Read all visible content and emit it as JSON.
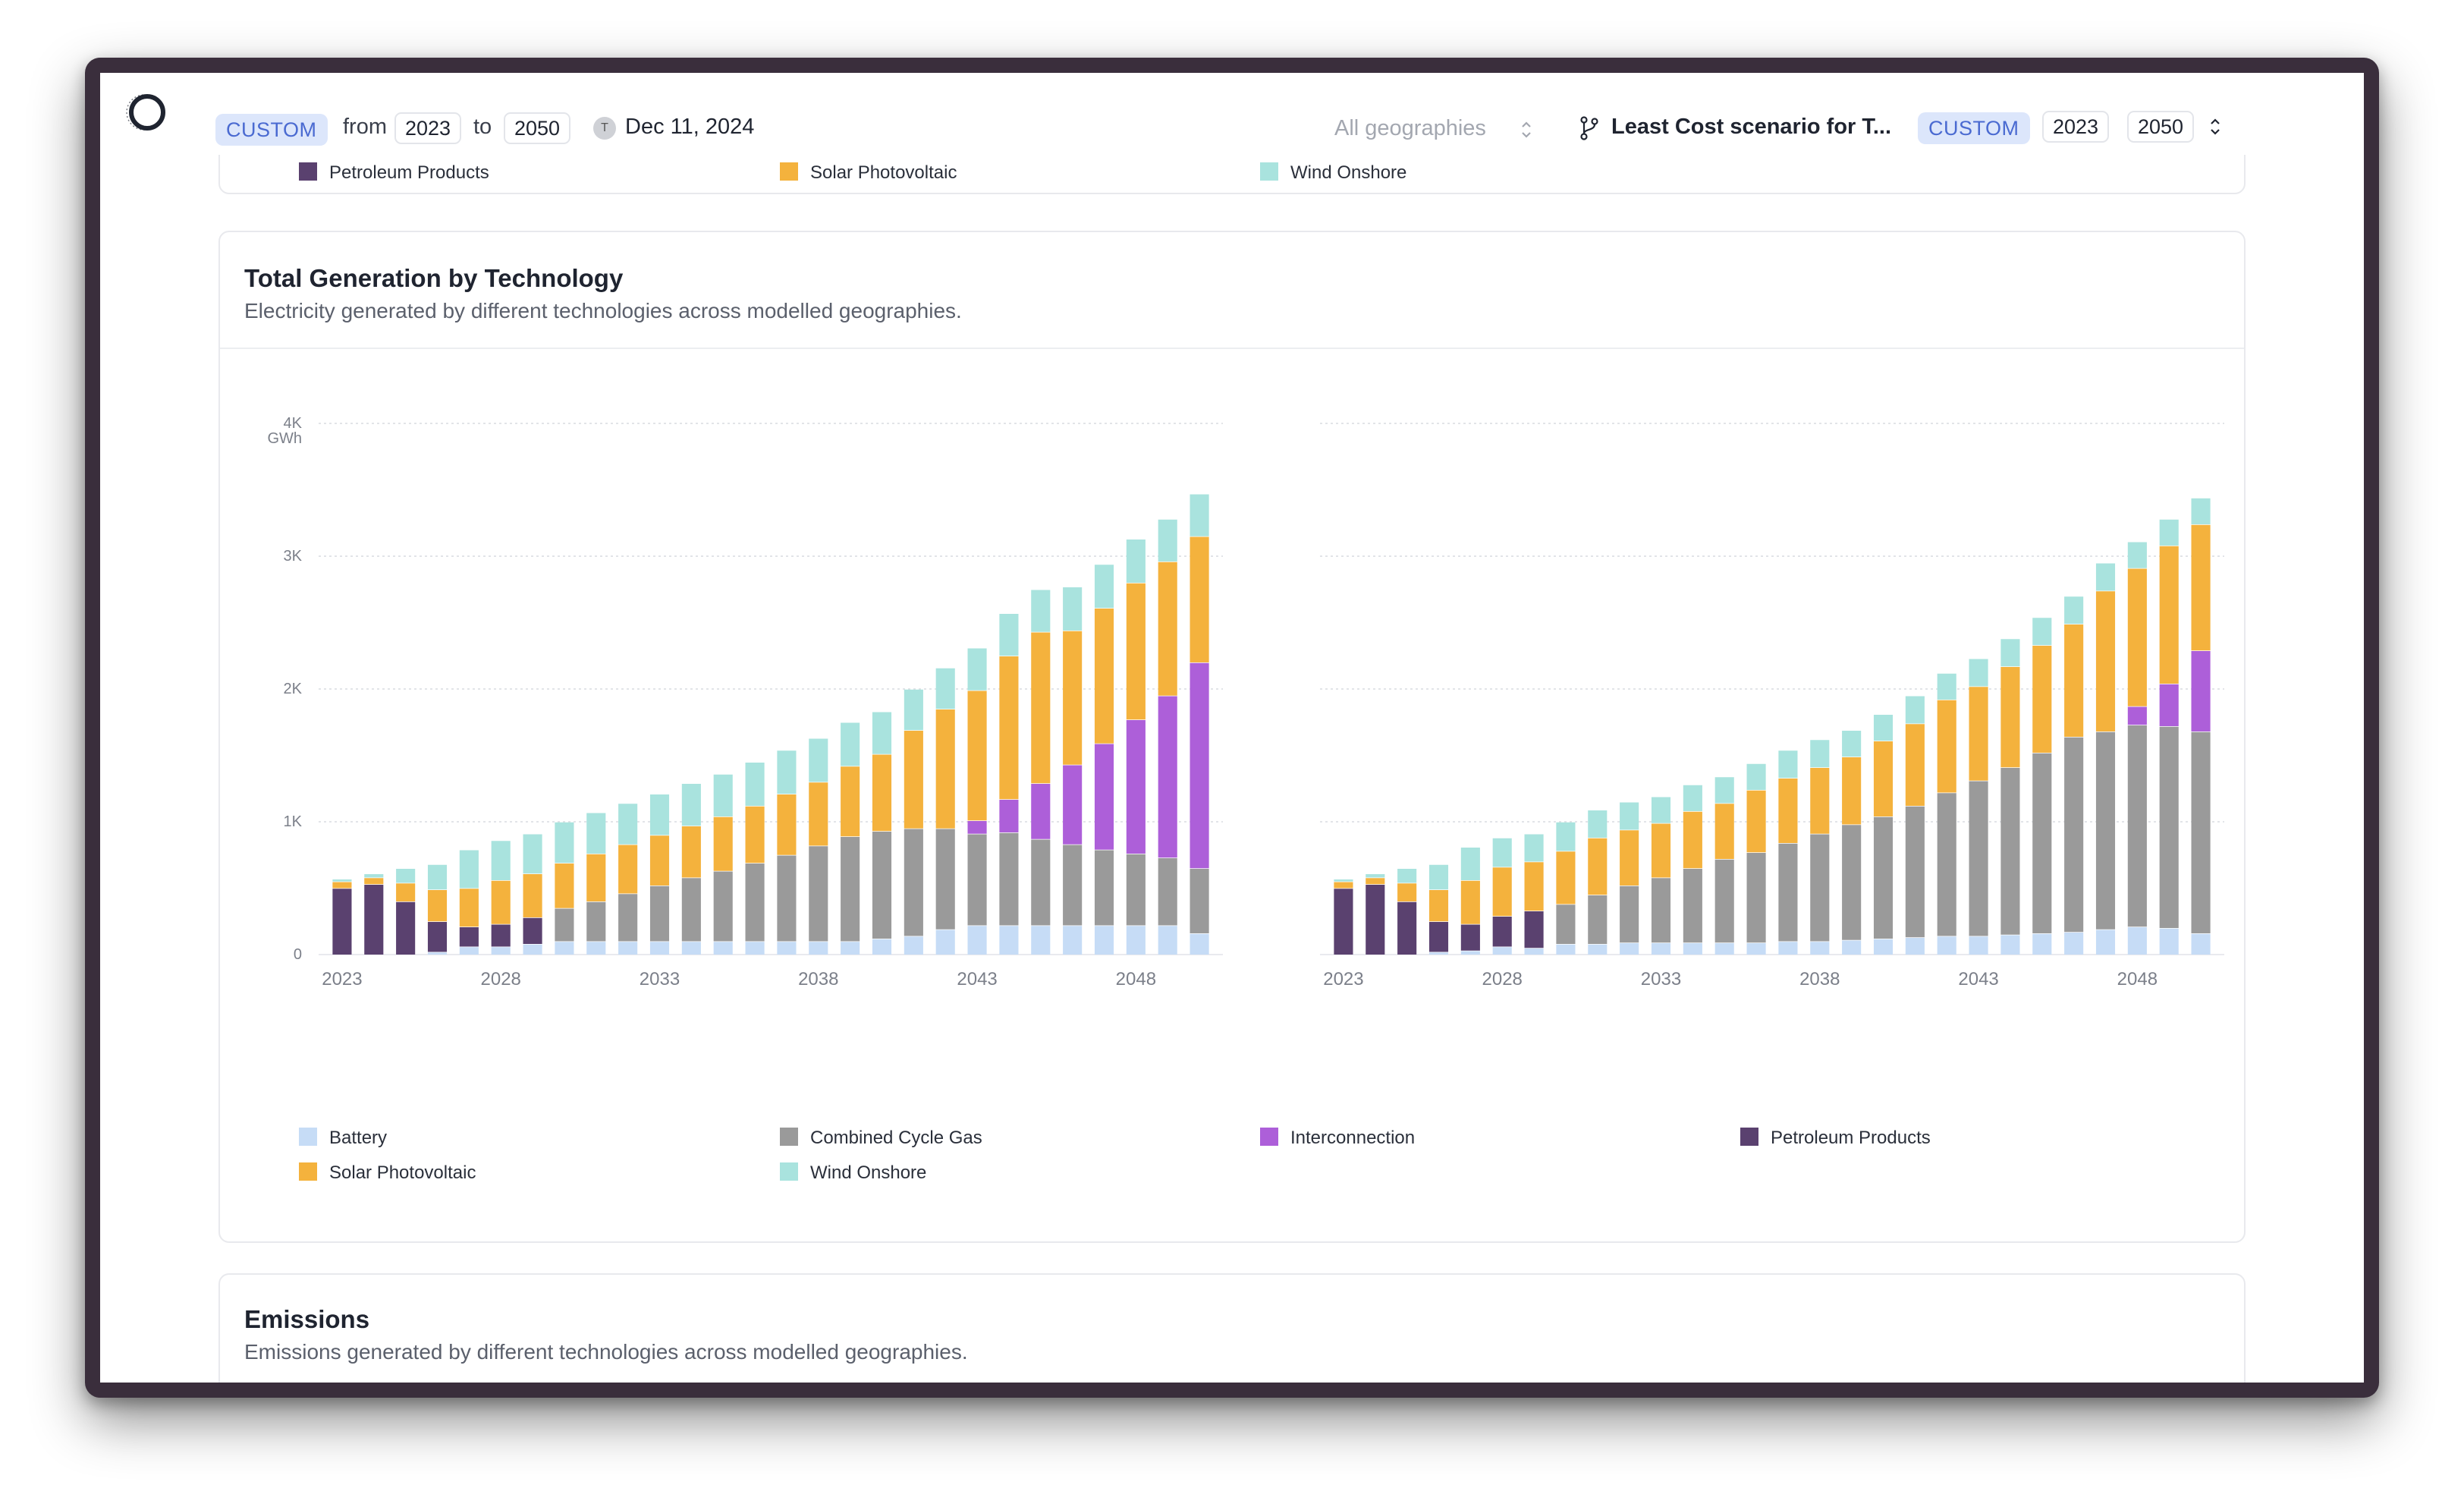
{
  "header": {
    "range_badge": "CUSTOM",
    "from_label": "from",
    "from_year": "2023",
    "to_label": "to",
    "to_year": "2050",
    "date_badge": "T",
    "date": "Dec 11, 2024",
    "geography": "All geographies",
    "scenario": "Least Cost scenario for T...",
    "scenario_badge": "CUSTOM",
    "scenario_from": "2023",
    "scenario_to": "2050"
  },
  "top_legend": [
    "Petroleum Products",
    "Solar Photovoltaic",
    "Wind Onshore"
  ],
  "generation_card": {
    "title": "Total Generation by Technology",
    "subtitle": "Electricity generated by different technologies across modelled geographies."
  },
  "emissions_card": {
    "title": "Emissions",
    "subtitle": "Emissions generated by different technologies across modelled geographies."
  },
  "colors": {
    "Battery": "#c6dcf6",
    "Combined Cycle Gas": "#9a9a9a",
    "Interconnection": "#ad5fd9",
    "Petroleum Products": "#5a416f",
    "Solar Photovoltaic": "#f4b23d",
    "Wind Onshore": "#a9e3de"
  },
  "chart_data": [
    {
      "type": "bar",
      "stacked": true,
      "unit": "GWh",
      "ylim": [
        0,
        4000
      ],
      "y_ticks": [
        0,
        1000,
        2000,
        3000,
        4000
      ],
      "y_tick_labels": [
        "0",
        "1K",
        "2K",
        "3K",
        "4K"
      ],
      "x": [
        2023,
        2024,
        2025,
        2026,
        2027,
        2028,
        2029,
        2030,
        2031,
        2032,
        2033,
        2034,
        2035,
        2036,
        2037,
        2038,
        2039,
        2040,
        2041,
        2042,
        2043,
        2044,
        2045,
        2046,
        2047,
        2048,
        2049,
        2050
      ],
      "x_tick_labels": [
        "2023",
        "2028",
        "2033",
        "2038",
        "2043",
        "2048"
      ],
      "series": [
        {
          "name": "Battery",
          "values": [
            0,
            0,
            0,
            20,
            60,
            60,
            80,
            100,
            100,
            100,
            100,
            100,
            100,
            100,
            100,
            100,
            100,
            120,
            140,
            190,
            220,
            220,
            220,
            220,
            220,
            220,
            220,
            160
          ]
        },
        {
          "name": "Petroleum Products",
          "values": [
            500,
            530,
            400,
            230,
            150,
            170,
            200,
            0,
            0,
            0,
            0,
            0,
            0,
            0,
            0,
            0,
            0,
            0,
            0,
            0,
            0,
            0,
            0,
            0,
            0,
            0,
            0,
            0
          ]
        },
        {
          "name": "Combined Cycle Gas",
          "values": [
            0,
            0,
            0,
            0,
            0,
            0,
            0,
            250,
            300,
            360,
            420,
            480,
            530,
            590,
            650,
            720,
            790,
            810,
            810,
            760,
            690,
            700,
            650,
            610,
            570,
            540,
            510,
            490
          ]
        },
        {
          "name": "Interconnection",
          "values": [
            0,
            0,
            0,
            0,
            0,
            0,
            0,
            0,
            0,
            0,
            0,
            0,
            0,
            0,
            0,
            0,
            0,
            0,
            0,
            0,
            100,
            250,
            420,
            600,
            800,
            1010,
            1220,
            1550
          ]
        },
        {
          "name": "Solar Photovoltaic",
          "values": [
            50,
            50,
            140,
            240,
            290,
            330,
            330,
            340,
            360,
            370,
            380,
            390,
            410,
            430,
            460,
            480,
            530,
            580,
            740,
            900,
            980,
            1080,
            1140,
            1010,
            1020,
            1030,
            1010,
            950
          ]
        },
        {
          "name": "Wind Onshore",
          "values": [
            20,
            30,
            110,
            190,
            290,
            300,
            300,
            310,
            310,
            310,
            310,
            320,
            320,
            330,
            330,
            330,
            330,
            320,
            310,
            310,
            320,
            320,
            320,
            330,
            330,
            330,
            320,
            320
          ]
        }
      ]
    },
    {
      "type": "bar",
      "stacked": true,
      "unit": "GWh",
      "ylim": [
        0,
        4000
      ],
      "x": [
        2023,
        2024,
        2025,
        2026,
        2027,
        2028,
        2029,
        2030,
        2031,
        2032,
        2033,
        2034,
        2035,
        2036,
        2037,
        2038,
        2039,
        2040,
        2041,
        2042,
        2043,
        2044,
        2045,
        2046,
        2047,
        2048,
        2049,
        2050
      ],
      "x_tick_labels": [
        "2023",
        "2028",
        "2033",
        "2038",
        "2043",
        "2048"
      ],
      "series": [
        {
          "name": "Battery",
          "values": [
            0,
            0,
            0,
            20,
            30,
            60,
            50,
            80,
            80,
            90,
            90,
            90,
            90,
            90,
            100,
            100,
            110,
            120,
            130,
            140,
            140,
            150,
            160,
            170,
            190,
            210,
            200,
            160
          ]
        },
        {
          "name": "Petroleum Products",
          "values": [
            500,
            530,
            400,
            230,
            200,
            230,
            280,
            0,
            0,
            0,
            0,
            0,
            0,
            0,
            0,
            0,
            0,
            0,
            0,
            0,
            0,
            0,
            0,
            0,
            0,
            0,
            0,
            0
          ]
        },
        {
          "name": "Combined Cycle Gas",
          "values": [
            0,
            0,
            0,
            0,
            0,
            0,
            0,
            300,
            370,
            430,
            490,
            560,
            630,
            680,
            740,
            810,
            870,
            920,
            990,
            1080,
            1170,
            1260,
            1360,
            1470,
            1490,
            1520,
            1520,
            1520
          ]
        },
        {
          "name": "Interconnection",
          "values": [
            0,
            0,
            0,
            0,
            0,
            0,
            0,
            0,
            0,
            0,
            0,
            0,
            0,
            0,
            0,
            0,
            0,
            0,
            0,
            0,
            0,
            0,
            0,
            0,
            0,
            140,
            320,
            610
          ]
        },
        {
          "name": "Solar Photovoltaic",
          "values": [
            50,
            50,
            140,
            240,
            330,
            370,
            370,
            400,
            430,
            420,
            410,
            430,
            420,
            470,
            490,
            500,
            510,
            570,
            620,
            700,
            710,
            760,
            810,
            850,
            1060,
            1040,
            1040,
            950
          ]
        },
        {
          "name": "Wind Onshore",
          "values": [
            20,
            30,
            110,
            190,
            250,
            220,
            210,
            220,
            210,
            210,
            200,
            200,
            200,
            200,
            210,
            210,
            200,
            200,
            210,
            200,
            210,
            210,
            210,
            210,
            210,
            200,
            200,
            200
          ]
        }
      ]
    }
  ],
  "legend": [
    "Battery",
    "Combined Cycle Gas",
    "Interconnection",
    "Petroleum Products",
    "Solar Photovoltaic",
    "Wind Onshore"
  ]
}
